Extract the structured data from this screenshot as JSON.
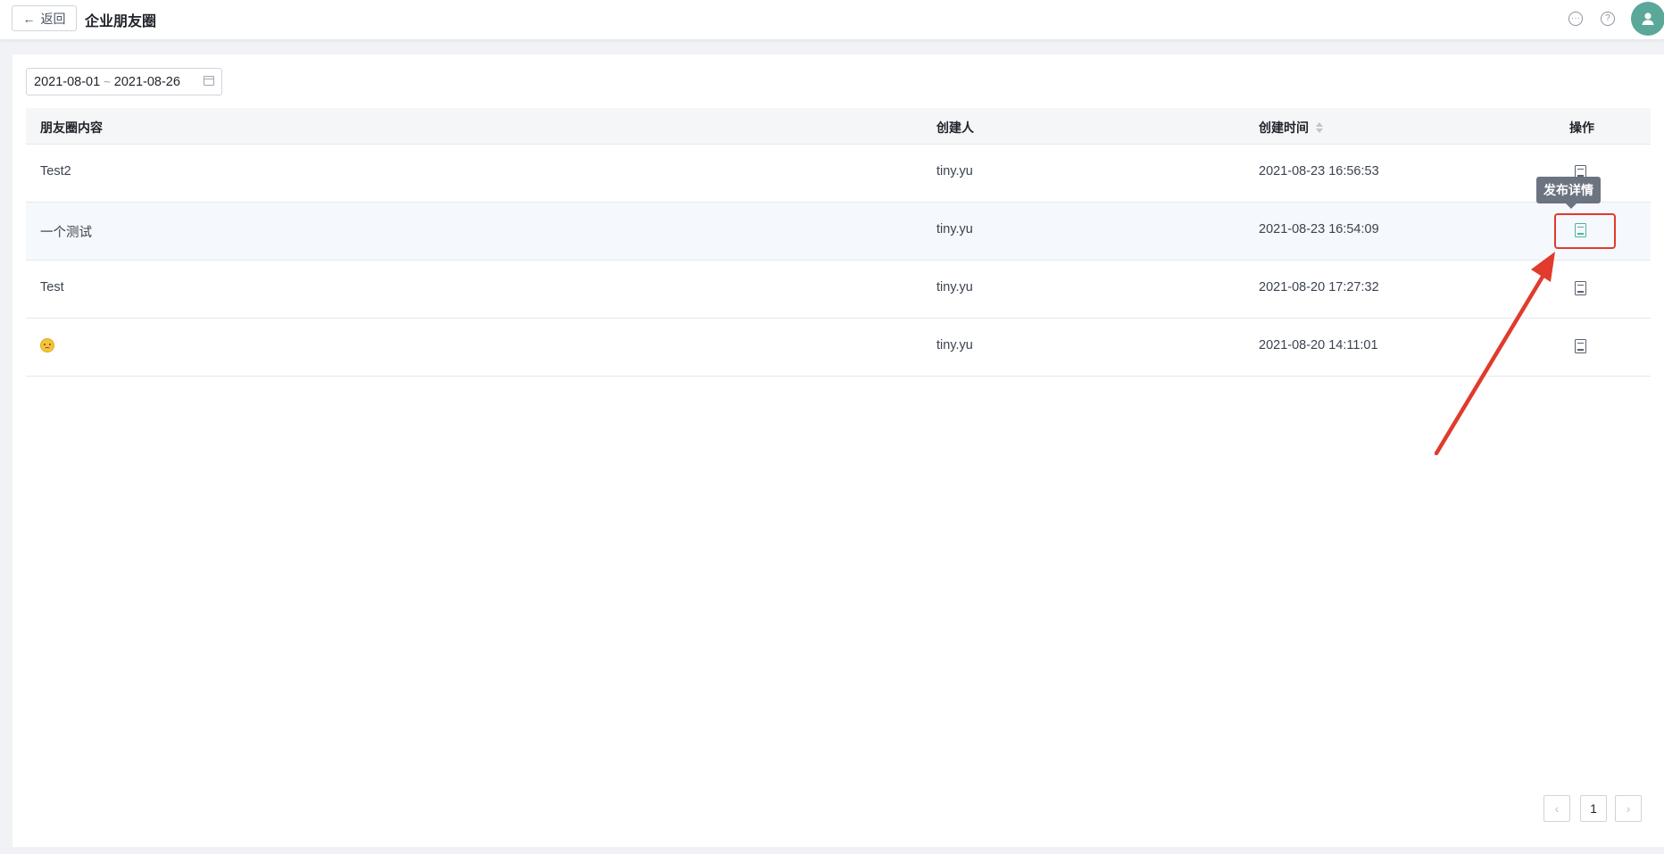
{
  "header": {
    "back_label": "返回",
    "title": "企业朋友圈",
    "icons": [
      "chat-icon",
      "help-icon",
      "user-avatar"
    ]
  },
  "filter": {
    "date_start": "2021-08-01",
    "date_sep": "~",
    "date_end": "2021-08-26"
  },
  "table": {
    "columns": [
      "朋友圈内容",
      "创建人",
      "创建时间",
      "操作"
    ],
    "rows": [
      {
        "content": "Test2",
        "creator": "tiny.yu",
        "time": "2021-08-23 16:56:53"
      },
      {
        "content": "一个测试",
        "creator": "tiny.yu",
        "time": "2021-08-23 16:54:09"
      },
      {
        "content": "Test",
        "creator": "tiny.yu",
        "time": "2021-08-20 17:27:32"
      },
      {
        "content": "🙃",
        "creator": "tiny.yu",
        "time": "2021-08-20 14:11:01"
      }
    ]
  },
  "tooltip": {
    "label": "发布详情"
  },
  "pagination": {
    "prev": "‹",
    "page": "1",
    "next": "›"
  },
  "colors": {
    "accent": "#4fb3a3",
    "annotation": "#e03b2c",
    "avatar": "#5aa89a"
  }
}
